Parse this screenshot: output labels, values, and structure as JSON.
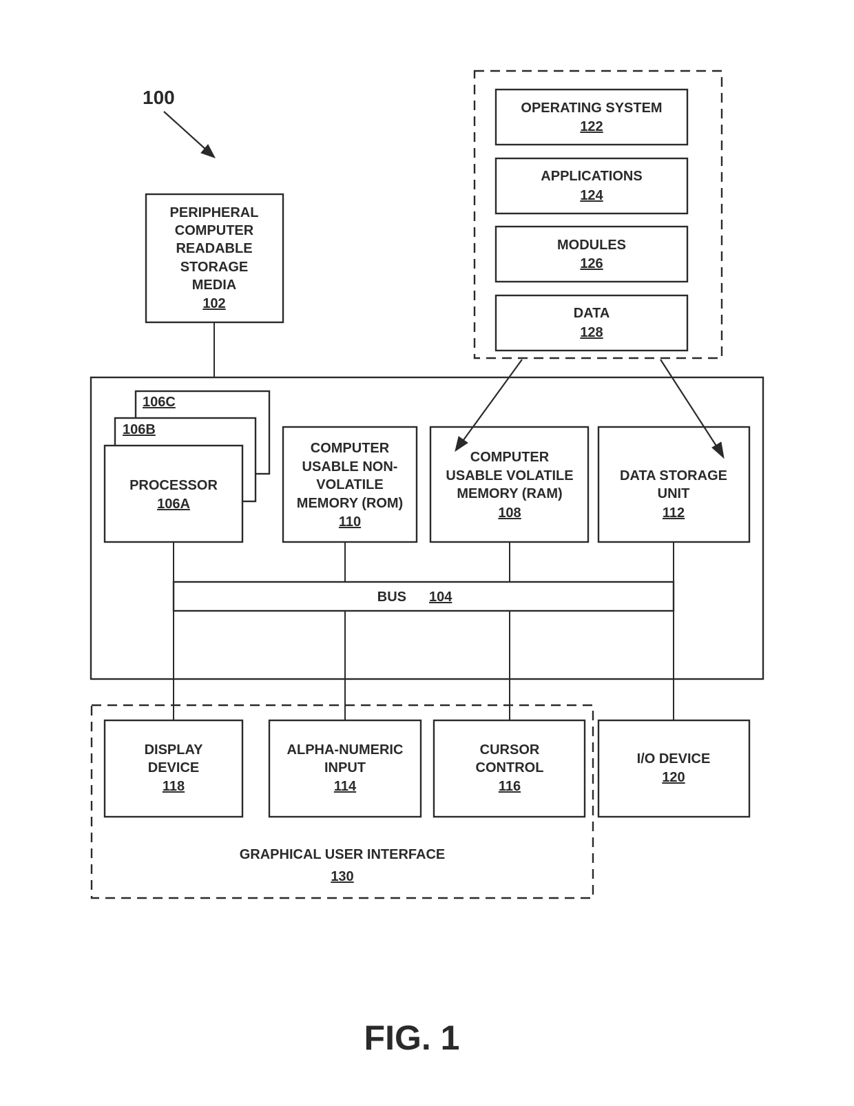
{
  "figure": {
    "system_ref": "100",
    "caption": "FIG. 1"
  },
  "peripheral": {
    "lines": [
      "PERIPHERAL",
      "COMPUTER",
      "READABLE",
      "STORAGE",
      "MEDIA"
    ],
    "ref": "102"
  },
  "software_stack": {
    "items": [
      {
        "label": "OPERATING SYSTEM",
        "ref": "122"
      },
      {
        "label": "APPLICATIONS",
        "ref": "124"
      },
      {
        "label": "MODULES",
        "ref": "126"
      },
      {
        "label": "DATA",
        "ref": "128"
      }
    ]
  },
  "processors": {
    "back": {
      "ref": "106C"
    },
    "middle": {
      "ref": "106B"
    },
    "front": {
      "label": "PROCESSOR",
      "ref": "106A"
    }
  },
  "rom": {
    "lines": [
      "COMPUTER",
      "USABLE NON-",
      "VOLATILE",
      "MEMORY (ROM)"
    ],
    "ref": "110"
  },
  "ram": {
    "lines": [
      "COMPUTER",
      "USABLE VOLATILE",
      "MEMORY (RAM)"
    ],
    "ref": "108"
  },
  "storage": {
    "lines": [
      "DATA STORAGE",
      "UNIT"
    ],
    "ref": "112"
  },
  "bus": {
    "label": "BUS",
    "ref": "104"
  },
  "display": {
    "lines": [
      "DISPLAY",
      "DEVICE"
    ],
    "ref": "118"
  },
  "alnum": {
    "lines": [
      "ALPHA-NUMERIC",
      "INPUT"
    ],
    "ref": "114"
  },
  "cursor": {
    "lines": [
      "CURSOR",
      "CONTROL"
    ],
    "ref": "116"
  },
  "io": {
    "lines": [
      "I/O DEVICE"
    ],
    "ref": "120"
  },
  "gui": {
    "label": "GRAPHICAL USER INTERFACE",
    "ref": "130"
  }
}
